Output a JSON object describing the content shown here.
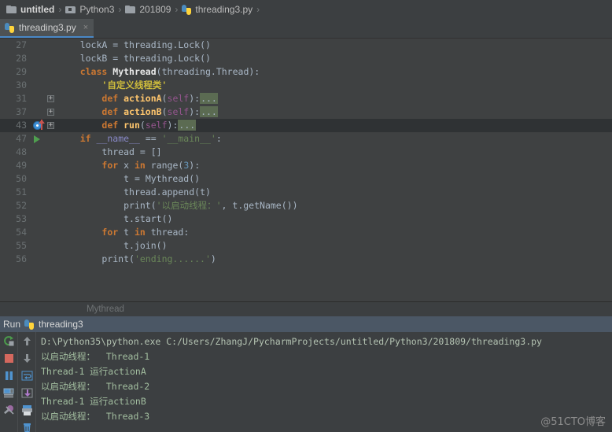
{
  "breadcrumb": {
    "items": [
      {
        "label": "untitled",
        "icon": "folder-icon"
      },
      {
        "label": "Python3",
        "icon": "source-folder-icon"
      },
      {
        "label": "201809",
        "icon": "folder-icon"
      },
      {
        "label": "threading3.py",
        "icon": "python-file-icon"
      }
    ],
    "separator": "›"
  },
  "tabs": {
    "active": {
      "label": "threading3.py",
      "close": "×",
      "icon": "python-file-icon"
    }
  },
  "editor": {
    "lines": [
      {
        "num": "27",
        "marker": "",
        "fold": "",
        "current": false,
        "tokens": [
          {
            "t": "    ",
            "c": "sy"
          },
          {
            "t": "lockA",
            "c": "id"
          },
          {
            "t": " = ",
            "c": "sy"
          },
          {
            "t": "threading",
            "c": "id"
          },
          {
            "t": ".",
            "c": "sy"
          },
          {
            "t": "Lock",
            "c": "id"
          },
          {
            "t": "()",
            "c": "sy"
          }
        ]
      },
      {
        "num": "28",
        "marker": "",
        "fold": "",
        "current": false,
        "tokens": [
          {
            "t": "    ",
            "c": "sy"
          },
          {
            "t": "lockB",
            "c": "id"
          },
          {
            "t": " = ",
            "c": "sy"
          },
          {
            "t": "threading",
            "c": "id"
          },
          {
            "t": ".",
            "c": "sy"
          },
          {
            "t": "Lock",
            "c": "id"
          },
          {
            "t": "()",
            "c": "sy"
          }
        ]
      },
      {
        "num": "29",
        "marker": "",
        "fold": "",
        "current": false,
        "tokens": [
          {
            "t": "    ",
            "c": "sy"
          },
          {
            "t": "class",
            "c": "k"
          },
          {
            "t": " ",
            "c": "sy"
          },
          {
            "t": "Mythread",
            "c": "cls"
          },
          {
            "t": "(",
            "c": "sy"
          },
          {
            "t": "threading.Thread",
            "c": "id"
          },
          {
            "t": "):",
            "c": "sy"
          }
        ]
      },
      {
        "num": "30",
        "marker": "",
        "fold": "",
        "current": false,
        "tokens": [
          {
            "t": "        ",
            "c": "sy"
          },
          {
            "t": "'自定义线程类'",
            "c": "doc"
          }
        ]
      },
      {
        "num": "31",
        "marker": "",
        "fold": "+",
        "current": false,
        "tokens": [
          {
            "t": "        ",
            "c": "sy"
          },
          {
            "t": "def",
            "c": "k"
          },
          {
            "t": " ",
            "c": "sy"
          },
          {
            "t": "actionA",
            "c": "fn"
          },
          {
            "t": "(",
            "c": "sy"
          },
          {
            "t": "self",
            "c": "self"
          },
          {
            "t": "):",
            "c": "sy"
          },
          {
            "t": "...",
            "c": "fold-ellipsis"
          }
        ]
      },
      {
        "num": "37",
        "marker": "",
        "fold": "+",
        "current": false,
        "tokens": [
          {
            "t": "        ",
            "c": "sy"
          },
          {
            "t": "def",
            "c": "k"
          },
          {
            "t": " ",
            "c": "sy"
          },
          {
            "t": "actionB",
            "c": "fn"
          },
          {
            "t": "(",
            "c": "sy"
          },
          {
            "t": "self",
            "c": "self"
          },
          {
            "t": "):",
            "c": "sy"
          },
          {
            "t": "...",
            "c": "fold-ellipsis"
          }
        ]
      },
      {
        "num": "43",
        "marker": "breakpoint",
        "fold": "+",
        "current": true,
        "tokens": [
          {
            "t": "        ",
            "c": "sy"
          },
          {
            "t": "def",
            "c": "k"
          },
          {
            "t": " ",
            "c": "sy"
          },
          {
            "t": "run",
            "c": "fn"
          },
          {
            "t": "(",
            "c": "sy"
          },
          {
            "t": "self",
            "c": "self"
          },
          {
            "t": "):",
            "c": "sy"
          },
          {
            "t": "...",
            "c": "fold-ellipsis"
          }
        ]
      },
      {
        "num": "47",
        "marker": "run",
        "fold": "",
        "current": false,
        "tokens": [
          {
            "t": "    ",
            "c": "sy"
          },
          {
            "t": "if",
            "c": "k"
          },
          {
            "t": " ",
            "c": "sy"
          },
          {
            "t": "__name__",
            "c": "predef"
          },
          {
            "t": " == ",
            "c": "sy"
          },
          {
            "t": "'__main__'",
            "c": "s"
          },
          {
            "t": ":",
            "c": "sy"
          }
        ]
      },
      {
        "num": "48",
        "marker": "",
        "fold": "",
        "current": false,
        "tokens": [
          {
            "t": "        ",
            "c": "sy"
          },
          {
            "t": "thread",
            "c": "id"
          },
          {
            "t": " = ",
            "c": "sy"
          },
          {
            "t": "[]",
            "c": "sy"
          }
        ]
      },
      {
        "num": "49",
        "marker": "",
        "fold": "",
        "current": false,
        "tokens": [
          {
            "t": "        ",
            "c": "sy"
          },
          {
            "t": "for",
            "c": "k"
          },
          {
            "t": " ",
            "c": "sy"
          },
          {
            "t": "x",
            "c": "id"
          },
          {
            "t": " ",
            "c": "sy"
          },
          {
            "t": "in",
            "c": "k"
          },
          {
            "t": " ",
            "c": "sy"
          },
          {
            "t": "range",
            "c": "id"
          },
          {
            "t": "(",
            "c": "sy"
          },
          {
            "t": "3",
            "c": "n"
          },
          {
            "t": "):",
            "c": "sy"
          }
        ]
      },
      {
        "num": "50",
        "marker": "",
        "fold": "",
        "current": false,
        "tokens": [
          {
            "t": "            ",
            "c": "sy"
          },
          {
            "t": "t",
            "c": "id"
          },
          {
            "t": " = ",
            "c": "sy"
          },
          {
            "t": "Mythread",
            "c": "id"
          },
          {
            "t": "()",
            "c": "sy"
          }
        ]
      },
      {
        "num": "51",
        "marker": "",
        "fold": "",
        "current": false,
        "tokens": [
          {
            "t": "            ",
            "c": "sy"
          },
          {
            "t": "thread",
            "c": "id"
          },
          {
            "t": ".",
            "c": "sy"
          },
          {
            "t": "append",
            "c": "id"
          },
          {
            "t": "(",
            "c": "sy"
          },
          {
            "t": "t",
            "c": "id"
          },
          {
            "t": ")",
            "c": "sy"
          }
        ]
      },
      {
        "num": "52",
        "marker": "",
        "fold": "",
        "current": false,
        "tokens": [
          {
            "t": "            ",
            "c": "sy"
          },
          {
            "t": "print",
            "c": "id"
          },
          {
            "t": "(",
            "c": "sy"
          },
          {
            "t": "'以启动线程：'",
            "c": "s"
          },
          {
            "t": ", ",
            "c": "sy"
          },
          {
            "t": "t",
            "c": "id"
          },
          {
            "t": ".",
            "c": "sy"
          },
          {
            "t": "getName",
            "c": "id"
          },
          {
            "t": "())",
            "c": "sy"
          }
        ]
      },
      {
        "num": "53",
        "marker": "",
        "fold": "",
        "current": false,
        "tokens": [
          {
            "t": "            ",
            "c": "sy"
          },
          {
            "t": "t",
            "c": "id"
          },
          {
            "t": ".",
            "c": "sy"
          },
          {
            "t": "start",
            "c": "id"
          },
          {
            "t": "()",
            "c": "sy"
          }
        ]
      },
      {
        "num": "54",
        "marker": "",
        "fold": "",
        "current": false,
        "tokens": [
          {
            "t": "        ",
            "c": "sy"
          },
          {
            "t": "for",
            "c": "k"
          },
          {
            "t": " ",
            "c": "sy"
          },
          {
            "t": "t",
            "c": "id"
          },
          {
            "t": " ",
            "c": "sy"
          },
          {
            "t": "in",
            "c": "k"
          },
          {
            "t": " ",
            "c": "sy"
          },
          {
            "t": "thread",
            "c": "id"
          },
          {
            "t": ":",
            "c": "sy"
          }
        ]
      },
      {
        "num": "55",
        "marker": "",
        "fold": "",
        "current": false,
        "tokens": [
          {
            "t": "            ",
            "c": "sy"
          },
          {
            "t": "t",
            "c": "id"
          },
          {
            "t": ".",
            "c": "sy"
          },
          {
            "t": "join",
            "c": "id"
          },
          {
            "t": "()",
            "c": "sy"
          }
        ]
      },
      {
        "num": "56",
        "marker": "",
        "fold": "",
        "current": false,
        "tokens": [
          {
            "t": "        ",
            "c": "sy"
          },
          {
            "t": "print",
            "c": "id"
          },
          {
            "t": "(",
            "c": "sy"
          },
          {
            "t": "'ending......'",
            "c": "s"
          },
          {
            "t": ")",
            "c": "sy"
          }
        ]
      }
    ]
  },
  "editor_footer": {
    "structure_label": "Mythread"
  },
  "run_window": {
    "title": "Run",
    "config_name": "threading3",
    "toolbar_left": [
      "rerun-icon",
      "stop-icon",
      "pause-icon",
      "print-icon",
      "mute-breakpoints-icon"
    ],
    "toolbar_right": [
      "scroll-up-icon",
      "scroll-down-icon",
      "soft-wrap-icon",
      "export-icon",
      "print-output-icon",
      "clear-all-icon"
    ],
    "console_lines": [
      {
        "text": "D:\\Python35\\python.exe C:/Users/ZhangJ/PycharmProjects/untitled/Python3/201809/threading3.py",
        "kind": "cmd"
      },
      {
        "text": "以启动线程：  Thread-1",
        "kind": "out"
      },
      {
        "text": "Thread-1 运行actionA",
        "kind": "out"
      },
      {
        "text": "以启动线程：  Thread-2",
        "kind": "out"
      },
      {
        "text": "Thread-1 运行actionB",
        "kind": "out"
      },
      {
        "text": "以启动线程：  Thread-3",
        "kind": "out"
      }
    ]
  },
  "watermark": {
    "text": "@51CTO博客"
  },
  "colors": {
    "background": "#3c3f41",
    "editor_background": "#3f4142",
    "run_header": "#4b5765",
    "tab_underline": "#4a88c7",
    "keyword": "#cc7832",
    "string": "#6a8759",
    "function": "#ffc66d",
    "number": "#6897bb",
    "self": "#94558d",
    "docstring": "#cfbd3c",
    "console_text": "#a3bfa0"
  }
}
